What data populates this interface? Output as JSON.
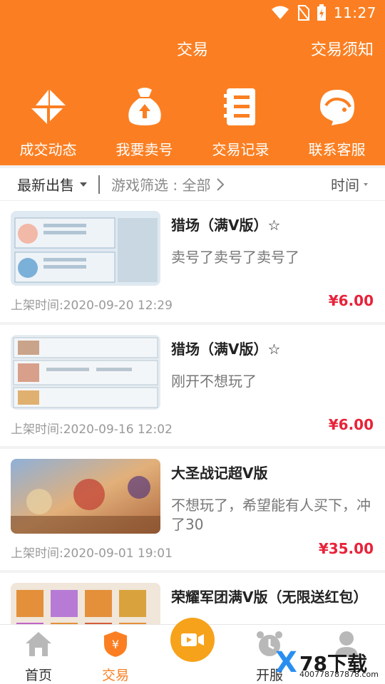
{
  "status": {
    "time": "11:27"
  },
  "header": {
    "title": "交易",
    "notice": "交易须知"
  },
  "quick_actions": [
    {
      "label": "成交动态",
      "icon": "deal-feed-icon"
    },
    {
      "label": "我要卖号",
      "icon": "sell-bag-icon"
    },
    {
      "label": "交易记录",
      "icon": "record-book-icon"
    },
    {
      "label": "联系客服",
      "icon": "customer-service-icon"
    }
  ],
  "filter": {
    "latest": "最新出售",
    "game": "游戏筛选 : 全部",
    "time": "时间"
  },
  "listings": [
    {
      "title": "猎场（满V版）☆",
      "desc": "卖号了卖号了卖号了",
      "time": "上架时间:2020-09-20 12:29",
      "price": "¥6.00"
    },
    {
      "title": "猎场（满V版）☆",
      "desc": "刚开不想玩了",
      "time": "上架时间:2020-09-16 12:02",
      "price": "¥6.00"
    },
    {
      "title": "大圣战记超V版",
      "desc": "不想玩了，希望能有人买下，冲了30",
      "time": "上架时间:2020-09-01 19:01",
      "price": "¥35.00"
    },
    {
      "title": "荣耀军团满V版（无限送红包）",
      "desc": "",
      "time": "",
      "price": ""
    }
  ],
  "tabs": [
    {
      "label": "首页",
      "icon": "home-icon"
    },
    {
      "label": "交易",
      "icon": "trade-shield-icon"
    },
    {
      "label": "",
      "icon": "video-icon"
    },
    {
      "label": "开服",
      "icon": "alarm-clock-icon"
    },
    {
      "label": "",
      "icon": "user-icon"
    }
  ],
  "watermark": {
    "brand_x": "X",
    "brand_78": "78下载",
    "url": "400778787878.com"
  },
  "colors": {
    "accent": "#fb7f22",
    "price": "#e8233a",
    "center_button": "#f7a21b"
  }
}
